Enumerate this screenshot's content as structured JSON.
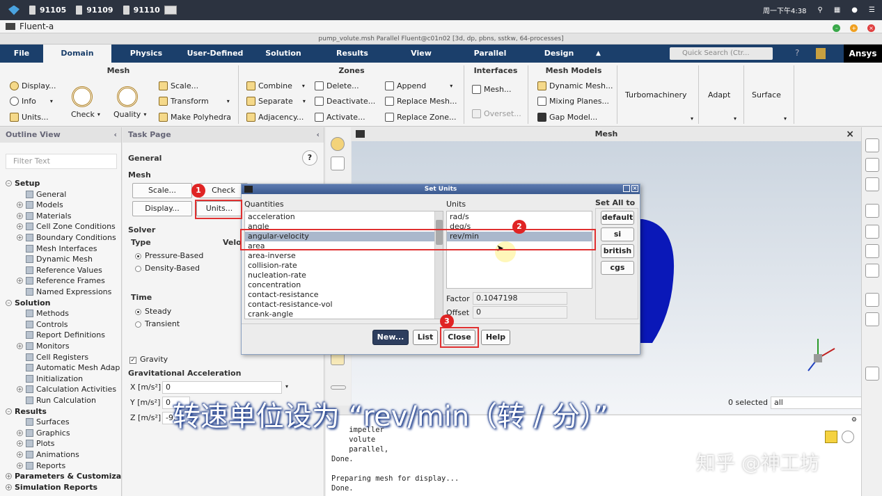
{
  "taskbar": {
    "items": [
      "91105",
      "91109",
      "91110"
    ],
    "clock": "周一下午4:38"
  },
  "app": {
    "title": "Fluent-a",
    "window_title": "pump_volute.msh Parallel Fluent@c01n02  [3d, dp, pbns, sstkw, 64-processes]"
  },
  "tabs": [
    "File",
    "Domain",
    "Physics",
    "User-Defined",
    "Solution",
    "Results",
    "View",
    "Parallel",
    "Design"
  ],
  "quick_search": "Quick Search (Ctr...",
  "brand": "Ansys",
  "ribbon": {
    "mesh": {
      "title": "Mesh",
      "display": "Display...",
      "info": "Info",
      "units": "Units...",
      "check": "Check",
      "quality": "Quality",
      "scale": "Scale...",
      "transform": "Transform",
      "make_polyhedra": "Make Polyhedra"
    },
    "zones": {
      "title": "Zones",
      "combine": "Combine",
      "separate": "Separate",
      "adjacency": "Adjacency...",
      "delete": "Delete...",
      "deactivate": "Deactivate...",
      "activate": "Activate...",
      "append": "Append",
      "replace_mesh": "Replace Mesh...",
      "replace_zone": "Replace Zone..."
    },
    "interfaces": {
      "title": "Interfaces",
      "mesh": "Mesh...",
      "overset": "Overset..."
    },
    "mesh_models": {
      "title": "Mesh Models",
      "dynamic": "Dynamic Mesh...",
      "mixing": "Mixing Planes...",
      "gap": "Gap Model..."
    },
    "others": [
      "Turbomachinery",
      "Adapt",
      "Surface"
    ]
  },
  "outline": {
    "title": "Outline View",
    "filter_placeholder": "Filter Text",
    "items": [
      "Setup",
      "General",
      "Models",
      "Materials",
      "Cell Zone Conditions",
      "Boundary Conditions",
      "Mesh Interfaces",
      "Dynamic Mesh",
      "Reference Values",
      "Reference Frames",
      "Named Expressions",
      "Solution",
      "Methods",
      "Controls",
      "Report Definitions",
      "Monitors",
      "Cell Registers",
      "Automatic Mesh Adap",
      "Initialization",
      "Calculation Activities",
      "Run Calculation",
      "Results",
      "Surfaces",
      "Graphics",
      "Plots",
      "Animations",
      "Reports",
      "Parameters & Customiza",
      "Simulation Reports"
    ]
  },
  "task": {
    "title": "Task Page",
    "general": "General",
    "mesh": "Mesh",
    "scale": "Scale...",
    "check": "Check",
    "display": "Display...",
    "units": "Units...",
    "solver": "Solver",
    "type": "Type",
    "velocity": "Velo",
    "pressure": "Pressure-Based",
    "density": "Density-Based",
    "time": "Time",
    "steady": "Steady",
    "transient": "Transient",
    "gravity": "Gravity",
    "grav_acc": "Gravitational Acceleration",
    "x_label": "X [m/s²]",
    "y_label": "Y [m/s²]",
    "z_label": "Z [m/s²]",
    "x_val": "0",
    "y_val": "0",
    "z_val": "-9."
  },
  "graphics": {
    "title": "Mesh",
    "selected": "0 selected",
    "filter": "all"
  },
  "console": {
    "text": "    impeller\n    volute\n    parallel,\nDone.\n\nPreparing mesh for display...\nDone."
  },
  "dialog": {
    "title": "Set Units",
    "quantities_label": "Quantities",
    "units_label": "Units",
    "set_all_label": "Set All to",
    "quantities": [
      "acceleration",
      "angle",
      "angular-velocity",
      "area",
      "area-inverse",
      "collision-rate",
      "nucleation-rate",
      "concentration",
      "contact-resistance",
      "contact-resistance-vol",
      "crank-angle"
    ],
    "units": [
      "rad/s",
      "deg/s",
      "rev/min"
    ],
    "factor_label": "Factor",
    "factor": "0.1047198",
    "offset_label": "Offset",
    "offset": "0",
    "set_all": [
      "default",
      "si",
      "british",
      "cgs"
    ],
    "buttons": {
      "new": "New...",
      "list": "List",
      "close": "Close",
      "help": "Help"
    }
  },
  "badges": [
    "1",
    "2",
    "3"
  ],
  "subtitle": "转速单位设为 “rev/min（转 / 分）”",
  "watermark": "知乎 @神工坊"
}
